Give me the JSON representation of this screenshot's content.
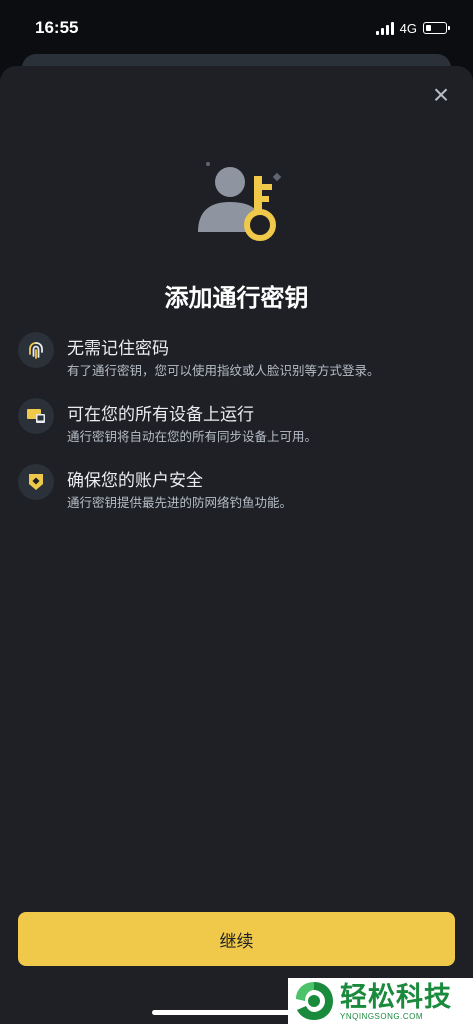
{
  "status_bar": {
    "time": "16:55",
    "network": "4G",
    "battery_level": 0.3
  },
  "sheet": {
    "close_icon": "×",
    "hero_icon": "passkey-user-key-icon",
    "title": "添加通行密钥",
    "features": [
      {
        "icon": "fingerprint-icon",
        "title": "无需记住密码",
        "description": "有了通行密钥，您可以使用指纹或人脸识别等方式登录。"
      },
      {
        "icon": "devices-icon",
        "title": "可在您的所有设备上运行",
        "description": "通行密钥将自动在您的所有同步设备上可用。"
      },
      {
        "icon": "shield-icon",
        "title": "确保您的账户安全",
        "description": "通行密钥提供最先进的防网络钓鱼功能。"
      }
    ],
    "continue_label": "继续"
  },
  "watermark": {
    "main": "轻松科技",
    "sub": "YNQINGSONG.COM"
  },
  "colors": {
    "accent": "#f0c94a",
    "sheet_bg": "#1e2026",
    "icon_bg": "#2b3139",
    "watermark_green": "#1a8a3c"
  }
}
